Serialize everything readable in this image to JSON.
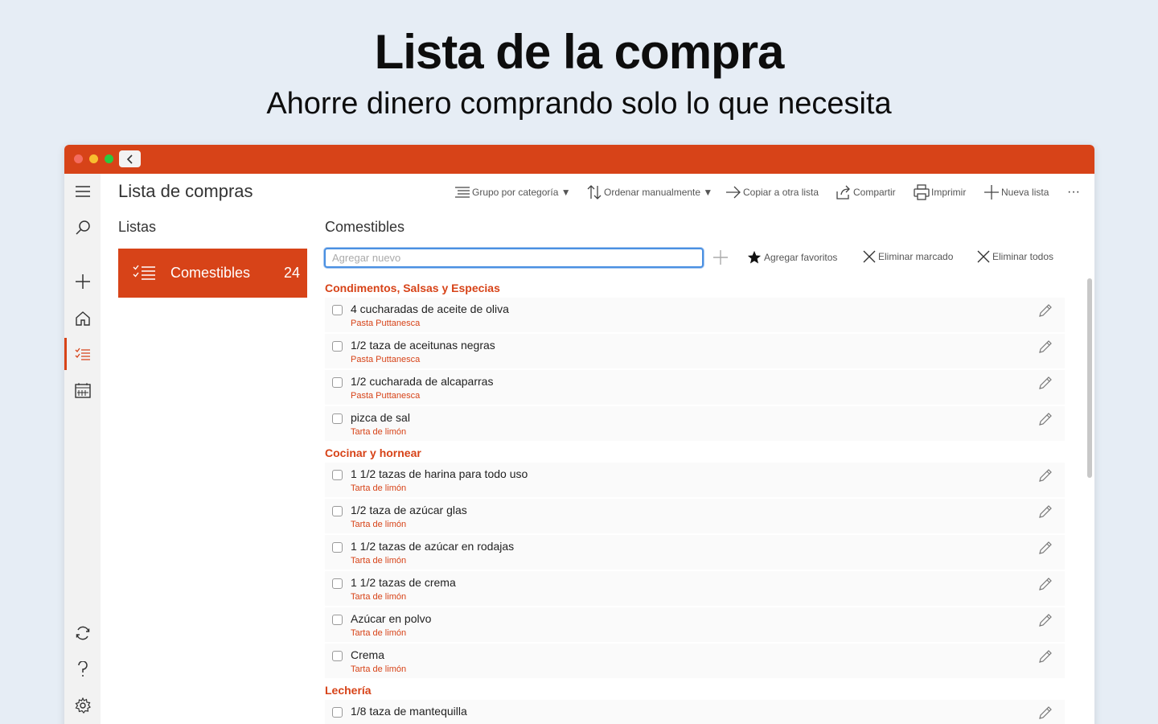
{
  "hero": {
    "title": "Lista de la compra",
    "subtitle": "Ahorre dinero comprando solo lo que necesita"
  },
  "colors": {
    "accent": "#d74318",
    "background": "#e6edf5"
  },
  "app": {
    "title": "Lista de compras"
  },
  "toolbar": {
    "group": "Grupo por categoría ▼",
    "sort": "Ordenar manualmente ▼",
    "copy": "Copiar a otra lista",
    "share": "Compartir",
    "print": "Imprimir",
    "new_list": "Nueva lista",
    "more": "···"
  },
  "lists": {
    "heading": "Listas",
    "items": [
      {
        "name": "Comestibles",
        "count": "24"
      }
    ]
  },
  "main": {
    "heading": "Comestibles",
    "add_placeholder": "Agregar nuevo",
    "add_value": "",
    "actions": {
      "favorites": "Agregar favoritos",
      "delete_checked": "Eliminar marcado",
      "delete_all": "Eliminar todos"
    },
    "categories": [
      {
        "name": "Condimentos, Salsas y Especias",
        "items": [
          {
            "name": "4 cucharadas de aceite de oliva",
            "source": "Pasta Puttanesca"
          },
          {
            "name": "1/2 taza de aceitunas negras",
            "source": "Pasta Puttanesca"
          },
          {
            "name": "1/2 cucharada de alcaparras",
            "source": "Pasta Puttanesca"
          },
          {
            "name": "pizca de sal",
            "source": "Tarta de limón"
          }
        ]
      },
      {
        "name": "Cocinar y hornear",
        "items": [
          {
            "name": "1 1/2 tazas de harina para todo uso",
            "source": "Tarta de limón"
          },
          {
            "name": "1/2 taza de azúcar glas",
            "source": "Tarta de limón"
          },
          {
            "name": "1 1/2 tazas de azúcar en rodajas",
            "source": "Tarta de limón"
          },
          {
            "name": "1 1/2 tazas de crema",
            "source": "Tarta de limón"
          },
          {
            "name": "Azúcar en polvo",
            "source": "Tarta de limón"
          },
          {
            "name": "Crema",
            "source": "Tarta de limón"
          }
        ]
      },
      {
        "name": "Lechería",
        "items": [
          {
            "name": "1/8 taza de mantequilla",
            "source": ""
          }
        ]
      }
    ]
  },
  "icons": {
    "rail": [
      "menu-icon",
      "search-icon",
      "plus-icon",
      "home-icon",
      "list-icon",
      "calendar-icon",
      "sync-icon",
      "help-icon",
      "settings-icon"
    ]
  }
}
